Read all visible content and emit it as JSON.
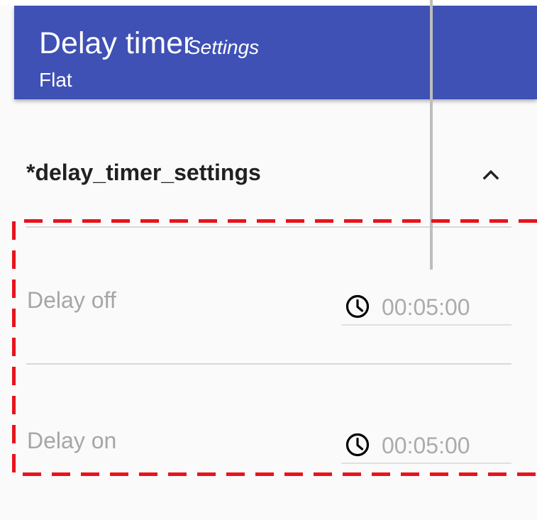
{
  "header": {
    "title": "Delay timer",
    "subtitle": "Settings",
    "device": "Flat",
    "background_color": "#3f51b5"
  },
  "section": {
    "title": "*delay_timer_settings",
    "expanded": true,
    "collapse_icon": "chevron-up-icon"
  },
  "settings": [
    {
      "label": "Delay off",
      "icon": "clock-icon",
      "value": "00:05:00"
    },
    {
      "label": "Delay on",
      "icon": "clock-icon",
      "value": "00:05:00"
    }
  ],
  "highlight_color": "#e8141b"
}
